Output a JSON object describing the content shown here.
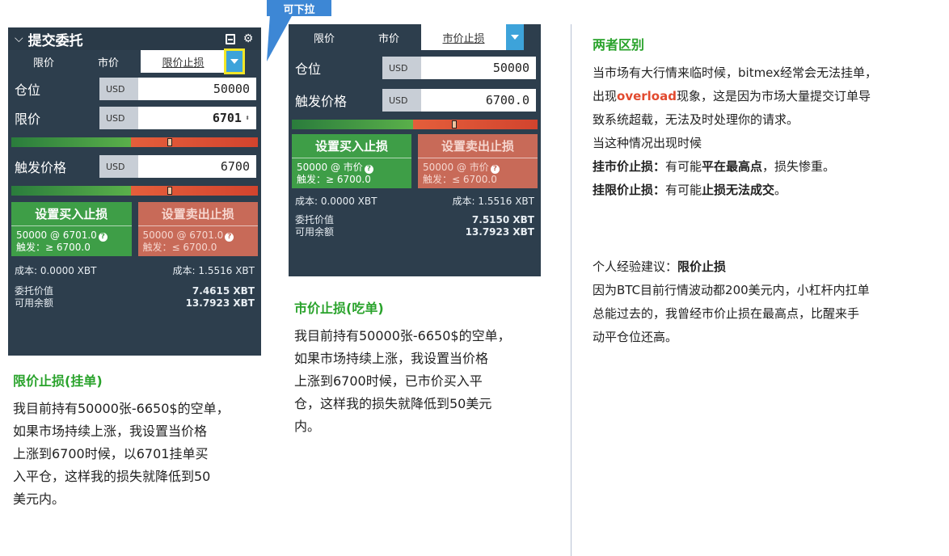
{
  "callout": {
    "label": "可下拉"
  },
  "panel1": {
    "title": "提交委托",
    "tabs": [
      "限价",
      "市价",
      "限价止损"
    ],
    "fields": [
      {
        "label": "仓位",
        "unit": "USD",
        "value": "50000"
      },
      {
        "label": "限价",
        "unit": "USD",
        "value": "6701"
      },
      {
        "label": "触发价格",
        "unit": "USD",
        "value": "6700"
      }
    ],
    "buy": {
      "title": "设置买入止损",
      "line1": "50000 @ 6701.0",
      "line2": "触发：≥ 6700.0",
      "cost": "成本: 0.0000 XBT"
    },
    "sell": {
      "title": "设置卖出止损",
      "line1": "50000 @ 6701.0",
      "line2": "触发：≤ 6700.0",
      "cost": "成本: 1.5516 XBT"
    },
    "order_value_label": "委托价值",
    "order_value": "7.4615 XBT",
    "available_label": "可用余额",
    "available": "13.7923 XBT"
  },
  "panel2": {
    "tabs": [
      "限价",
      "市价",
      "市价止损"
    ],
    "fields": [
      {
        "label": "仓位",
        "unit": "USD",
        "value": "50000"
      },
      {
        "label": "触发价格",
        "unit": "USD",
        "value": "6700.0"
      }
    ],
    "buy": {
      "title": "设置买入止损",
      "line1": "50000 @ 市价",
      "line2": "触发：≥ 6700.0",
      "cost": "成本: 0.0000 XBT"
    },
    "sell": {
      "title": "设置卖出止损",
      "line1": "50000 @ 市价",
      "line2": "触发：≤ 6700.0",
      "cost": "成本: 1.5516 XBT"
    },
    "order_value_label": "委托价值",
    "order_value": "7.5150 XBT",
    "available_label": "可用余额",
    "available": "13.7923 XBT"
  },
  "section1": {
    "heading": "限价止损(挂单)",
    "lines": [
      "我目前持有50000张-6650$的空单，",
      "如果市场持续上涨，我设置当价格",
      "上涨到6700时候，以6701挂单买",
      "入平仓，这样我的损失就降低到50",
      "美元内。"
    ]
  },
  "section2": {
    "heading": "市价止损(吃单)",
    "lines": [
      "我目前持有50000张-6650$的空单，",
      "如果市场持续上涨，我设置当价格",
      "上涨到6700时候，已市价买入平",
      "仓，这样我的损失就降低到50美元",
      "内。"
    ]
  },
  "section3": {
    "heading": "两者区别",
    "line1": "当市场有大行情来临时候，bitmex经常会无法挂单，",
    "line2_pre": "出现",
    "line2_red": "overload",
    "line2_post": "现象，这是因为市场大量提交订单导",
    "line3": "致系统超载，无法及时处理你的请求。",
    "line4": "当这种情况出现时候",
    "line5_b1": "挂市价止损：",
    "line5_t1": "有可能",
    "line5_b2": "平在最高点",
    "line5_t2": "，损失惨重。",
    "line6_b1": "挂限价止损：",
    "line6_t1": "有可能",
    "line6_b2": "止损无法成交",
    "line6_t2": "。",
    "advice_label": "个人经验建议：",
    "advice_value": "限价止损",
    "reason": [
      "因为BTC目前行情波动都200美元内，小杠杆内扛单",
      "总能过去的，我曾经市价止损在最高点，比醒来手",
      "动平仓位还高。"
    ]
  }
}
